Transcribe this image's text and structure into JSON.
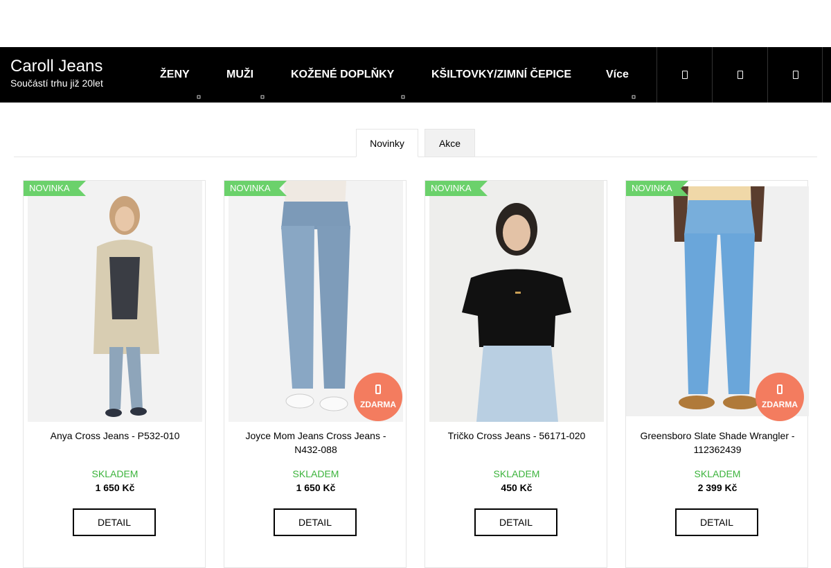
{
  "brand": {
    "title": "Caroll Jeans",
    "subtitle": "Součástí trhu již 20let"
  },
  "nav": [
    {
      "label": "ŽENY"
    },
    {
      "label": "MUŽI"
    },
    {
      "label": "KOŽENÉ DOPLŇKY"
    },
    {
      "label": "KŠILTOVKY/ZIMNÍ ČEPICE"
    },
    {
      "label": "Více"
    }
  ],
  "header_icons": [
    "search-icon",
    "user-icon",
    "cart-icon"
  ],
  "tabs": [
    {
      "label": "Novinky",
      "active": true
    },
    {
      "label": "Akce",
      "active": false
    }
  ],
  "products": [
    {
      "badge": "NOVINKA",
      "name": "Anya Cross Jeans - P532-010",
      "stock": "SKLADEM",
      "price": "1 650 Kč",
      "button": "DETAIL",
      "free_shipping": ""
    },
    {
      "badge": "NOVINKA",
      "name": "Joyce Mom Jeans Cross Jeans - N432-088",
      "stock": "SKLADEM",
      "price": "1 650 Kč",
      "button": "DETAIL",
      "free_shipping": "ZDARMA"
    },
    {
      "badge": "NOVINKA",
      "name": "Tričko Cross Jeans - 56171-020",
      "stock": "SKLADEM",
      "price": "450 Kč",
      "button": "DETAIL",
      "free_shipping": ""
    },
    {
      "badge": "NOVINKA",
      "name": "Greensboro Slate Shade Wrangler - 112362439",
      "stock": "SKLADEM",
      "price": "2 399 Kč",
      "button": "DETAIL",
      "free_shipping": "ZDARMA"
    }
  ],
  "colors": {
    "header_bg": "#000000",
    "stock_green": "#3bb33b",
    "badge_green": "#6bd16b",
    "free_orange": "#f37c5f"
  }
}
